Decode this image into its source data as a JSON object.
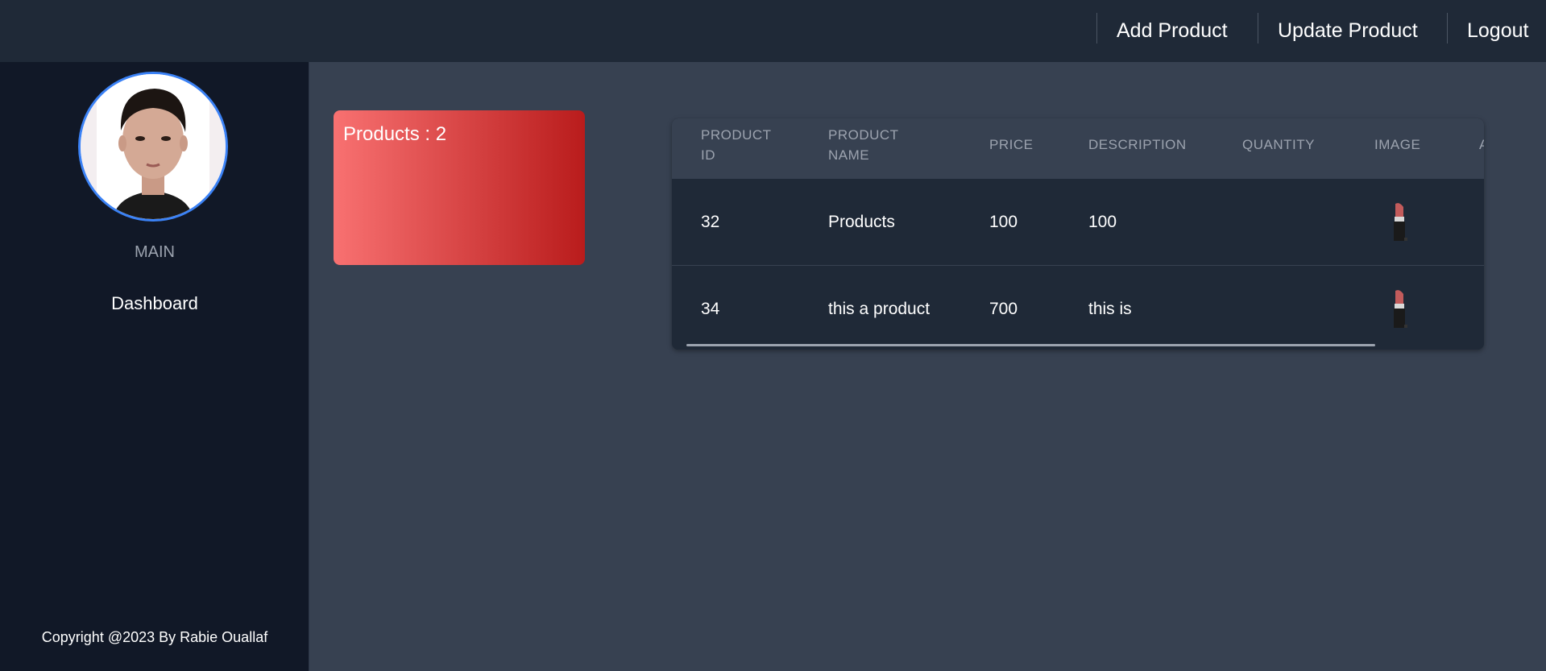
{
  "nav": {
    "add_product": "Add Product",
    "update_product": "Update Product",
    "logout": "Logout"
  },
  "sidebar": {
    "section": "MAIN",
    "items": [
      {
        "label": "Dashboard"
      }
    ],
    "copyright": "Copyright @2023 By Rabie Ouallaf"
  },
  "stats": {
    "products_label": "Products : 2"
  },
  "table": {
    "headers": [
      [
        "PRODUCT",
        "ID"
      ],
      [
        "PRODUCT",
        "NAME"
      ],
      [
        "PRICE"
      ],
      [
        "DESCRIPTION"
      ],
      [
        "QUANTITY"
      ],
      [
        "IMAGE"
      ],
      [
        "A"
      ]
    ],
    "rows": [
      {
        "id": "32",
        "name": "Products",
        "price": "100",
        "description": "100",
        "quantity": "",
        "image": "lipstick-icon"
      },
      {
        "id": "34",
        "name": "this a product",
        "price": "700",
        "description": "this is",
        "quantity": "",
        "image": "lipstick-icon"
      }
    ]
  },
  "colors": {
    "topbar": "#1f2937",
    "sidebar": "#111827",
    "content": "#374151",
    "card_gradient_start": "#f87171",
    "card_gradient_end": "#b91c1c",
    "avatar_border": "#3b82f6"
  }
}
